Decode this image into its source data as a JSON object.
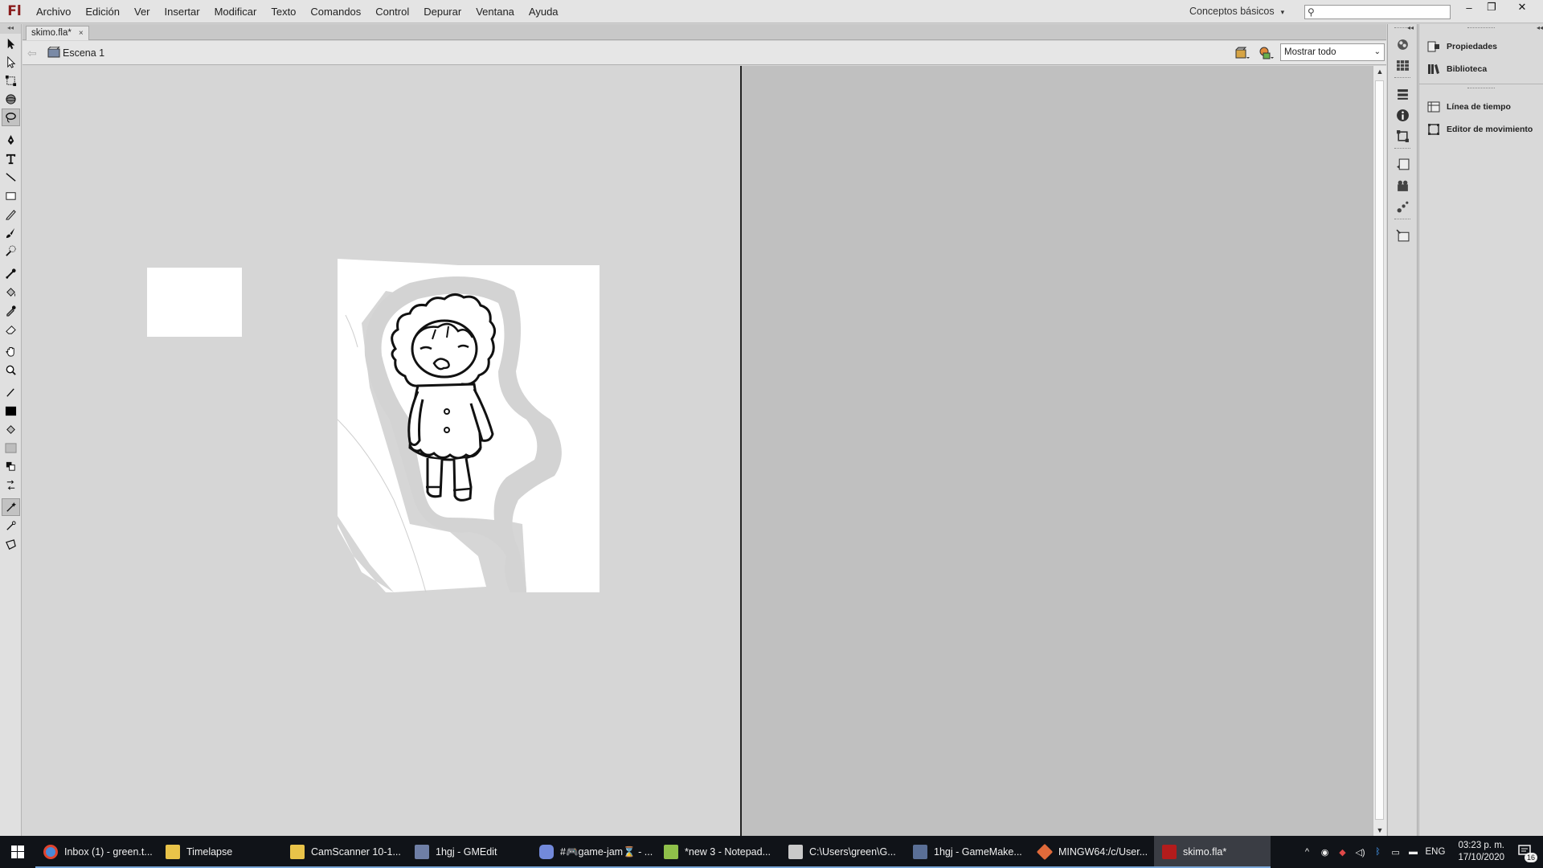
{
  "app": {
    "logo": "Fl"
  },
  "menu": [
    "Archivo",
    "Edición",
    "Ver",
    "Insertar",
    "Modificar",
    "Texto",
    "Comandos",
    "Control",
    "Depurar",
    "Ventana",
    "Ayuda"
  ],
  "workspace": {
    "label": "Conceptos básicos"
  },
  "search": {
    "value": ""
  },
  "window_controls": {
    "minimize": "–",
    "restore": "❐",
    "close": "✕"
  },
  "document": {
    "tab_label": "skimo.fla*",
    "tab_close": "×"
  },
  "scene": {
    "label": "Escena 1"
  },
  "zoom": {
    "value": "Mostrar todo",
    "options": [
      "Mostrar todo"
    ]
  },
  "panels": {
    "group1": [
      "Propiedades",
      "Biblioteca"
    ],
    "group2": [
      "Línea de tiempo",
      "Editor de movimiento"
    ]
  },
  "taskbar": {
    "items": [
      {
        "label": "Inbox (1) - green.t...",
        "icon": "chrome-icon",
        "color": "#4a8bd8"
      },
      {
        "label": "Timelapse",
        "icon": "folder-icon",
        "color": "#e9c349"
      },
      {
        "label": "CamScanner 10-1...",
        "icon": "folder-icon",
        "color": "#e9c349"
      },
      {
        "label": "1hgj - GMEdit",
        "icon": "gmedit-icon",
        "color": "#6f7fa6"
      },
      {
        "label": "#🎮game-jam⌛ - ...",
        "icon": "discord-icon",
        "color": "#7289da"
      },
      {
        "label": "*new 3 - Notepad...",
        "icon": "notepad-icon",
        "color": "#8fc04a"
      },
      {
        "label": "C:\\Users\\green\\G...",
        "icon": "terminal-icon",
        "color": "#c9c9c9"
      },
      {
        "label": "1hgj - GameMake...",
        "icon": "gamemaker-icon",
        "color": "#5a6f96"
      },
      {
        "label": "MINGW64:/c/User...",
        "icon": "git-icon",
        "color": "#e06a3a"
      },
      {
        "label": "skimo.fla*",
        "icon": "flash-icon",
        "color": "#b31c1c",
        "active": true
      }
    ],
    "tray": {
      "language": "ENG",
      "time": "03:23 p. m.",
      "date": "17/10/2020",
      "notifications": "16"
    }
  }
}
